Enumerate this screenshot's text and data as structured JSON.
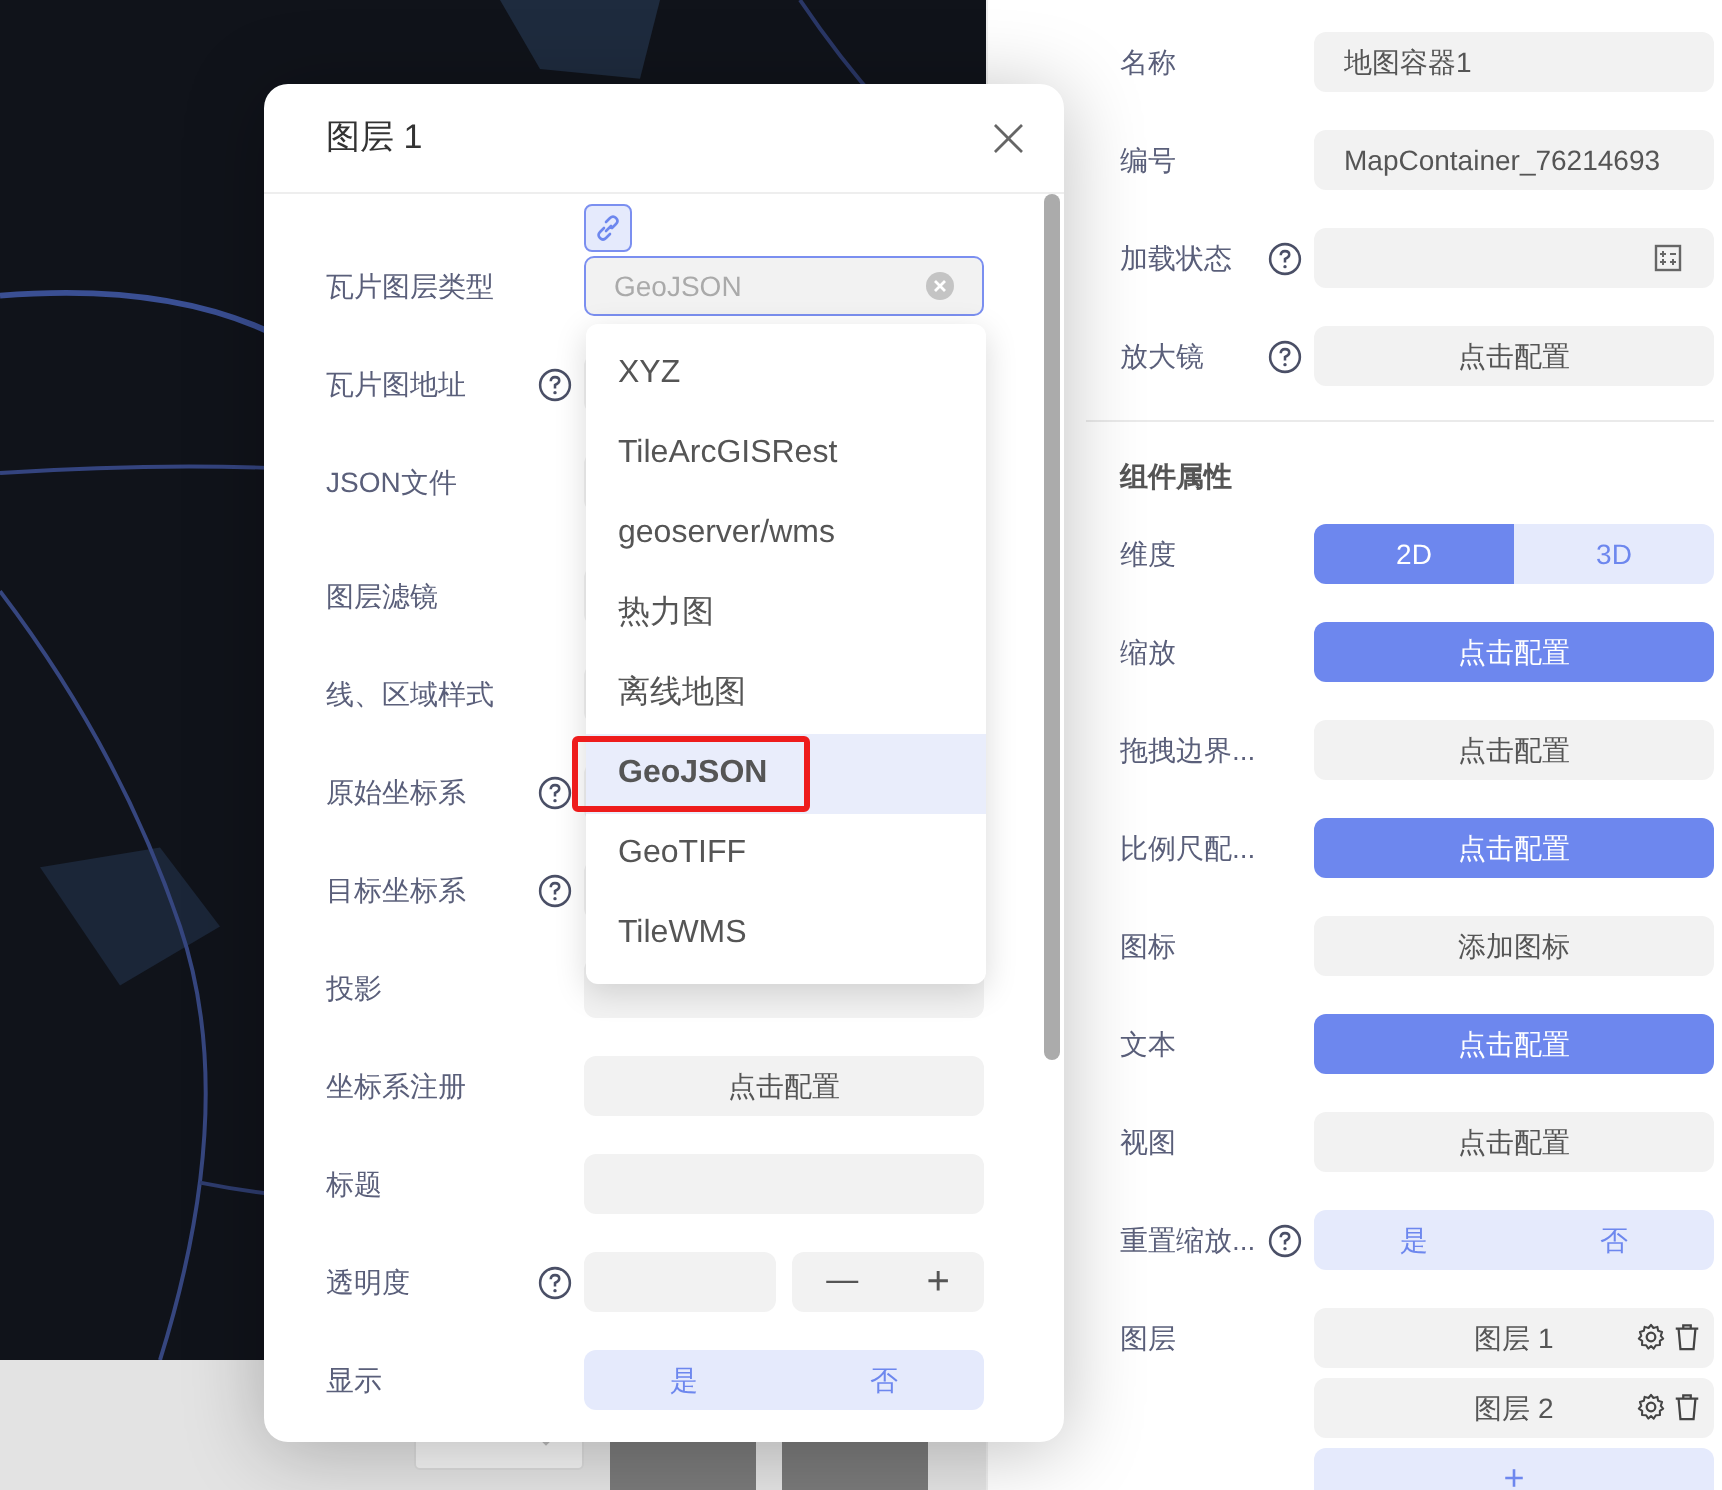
{
  "dialog": {
    "title": "图层 1",
    "close": "×",
    "rows": [
      {
        "kind": "select",
        "label": "瓦片图层类型",
        "placeholder": "GeoJSON"
      },
      {
        "kind": "input",
        "label": "瓦片图地址",
        "help": true
      },
      {
        "kind": "input",
        "label": "JSON文件"
      },
      {
        "kind": "input",
        "label": "图层滤镜"
      },
      {
        "kind": "input",
        "label": "线、区域样式"
      },
      {
        "kind": "input",
        "label": "原始坐标系",
        "help": true
      },
      {
        "kind": "input",
        "label": "目标坐标系",
        "help": true
      },
      {
        "kind": "input",
        "label": "投影"
      },
      {
        "kind": "button",
        "label": "坐标系注册",
        "text": "点击配置",
        "primary": false
      },
      {
        "kind": "input",
        "label": "标题"
      },
      {
        "kind": "stepper",
        "label": "透明度",
        "help": true,
        "minus": "—",
        "plus": "+"
      },
      {
        "kind": "segmented",
        "label": "显示",
        "options": [
          {
            "label": "是",
            "selected": false
          },
          {
            "label": "否",
            "selected": false
          }
        ]
      }
    ],
    "dropdown": {
      "options": [
        {
          "label": "XYZ",
          "selected": false
        },
        {
          "label": "TileArcGISRest",
          "selected": false
        },
        {
          "label": "geoserver/wms",
          "selected": false
        },
        {
          "label": "热力图",
          "selected": false
        },
        {
          "label": "离线地图",
          "selected": false
        },
        {
          "label": "GeoJSON",
          "selected": true,
          "annotated": true
        },
        {
          "label": "GeoTIFF",
          "selected": false
        },
        {
          "label": "TileWMS",
          "selected": false
        }
      ]
    }
  },
  "properties": {
    "rows": [
      {
        "kind": "input",
        "label": "名称",
        "value": "地图容器1"
      },
      {
        "kind": "input",
        "label": "编号",
        "value": "MapContainer_76214693"
      },
      {
        "kind": "picker",
        "label": "加载状态",
        "help": true
      },
      {
        "kind": "button",
        "label": "放大镜",
        "help": true,
        "text": "点击配置",
        "primary": false
      }
    ],
    "section_title": "组件属性",
    "component_rows": [
      {
        "kind": "segmented",
        "label": "维度",
        "options": [
          {
            "label": "2D",
            "selected": true
          },
          {
            "label": "3D",
            "selected": false
          }
        ]
      },
      {
        "kind": "button",
        "label": "缩放",
        "text": "点击配置",
        "primary": true
      },
      {
        "kind": "button",
        "label": "拖拽边界...",
        "text": "点击配置",
        "primary": false
      },
      {
        "kind": "button",
        "label": "比例尺配...",
        "text": "点击配置",
        "primary": true
      },
      {
        "kind": "button",
        "label": "图标",
        "text": "添加图标",
        "primary": false
      },
      {
        "kind": "button",
        "label": "文本",
        "text": "点击配置",
        "primary": true
      },
      {
        "kind": "button",
        "label": "视图",
        "text": "点击配置",
        "primary": false
      },
      {
        "kind": "segmented",
        "label": "重置缩放...",
        "help": true,
        "options": [
          {
            "label": "是",
            "selected": false
          },
          {
            "label": "否",
            "selected": false
          }
        ]
      },
      {
        "kind": "layers",
        "label": "图层",
        "items": [
          {
            "name": "图层 1"
          },
          {
            "name": "图层 2"
          }
        ],
        "add": "+"
      }
    ]
  }
}
